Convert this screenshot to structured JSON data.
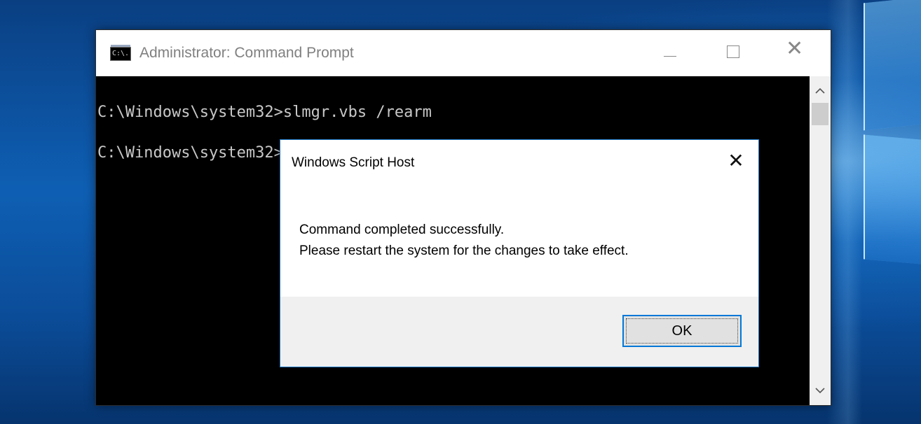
{
  "cmd_window": {
    "title": "Administrator: Command Prompt",
    "icon_text": "C:\\.",
    "lines": [
      "C:\\Windows\\system32>slmgr.vbs /rearm",
      "C:\\Windows\\system32>"
    ],
    "controls": {
      "minimize": "minimize-icon",
      "maximize": "maximize-icon",
      "close": "close-icon"
    },
    "scrollbar": {
      "up": "^",
      "down": "v"
    }
  },
  "dialog": {
    "title": "Windows Script Host",
    "close_label": "✕",
    "message_line1": "Command completed successfully.",
    "message_line2": "Please restart the system for the changes to take effect.",
    "ok_label": "OK"
  },
  "colors": {
    "accent": "#0078d7",
    "console_bg": "#000000",
    "console_text": "#c8c8c8",
    "desktop": "#0e5fb4"
  }
}
